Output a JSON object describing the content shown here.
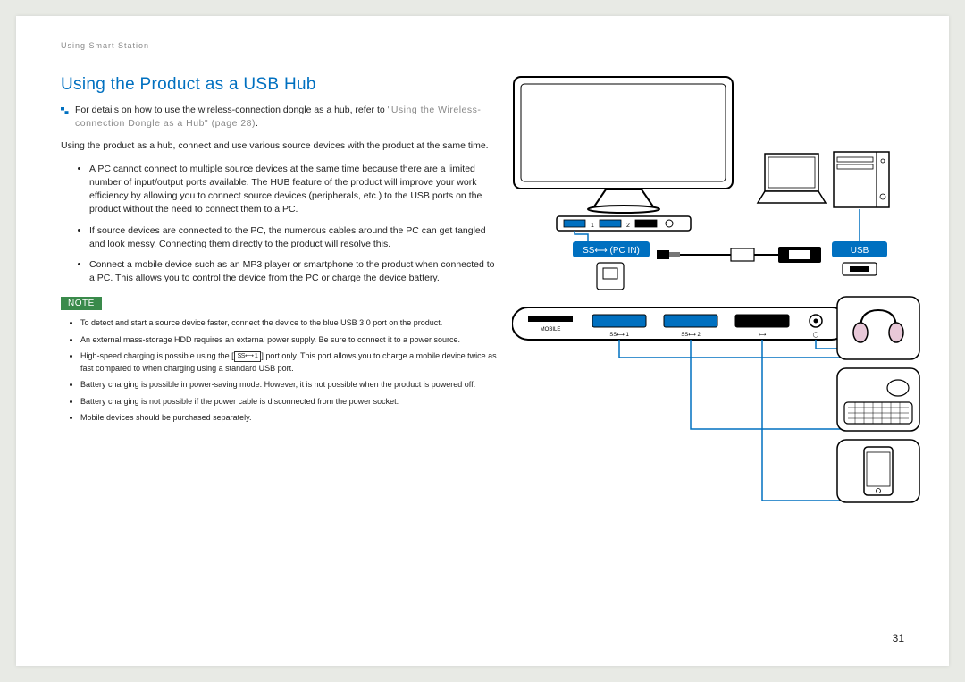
{
  "breadcrumb": "Using Smart Station",
  "title": "Using the Product as a USB Hub",
  "lead_text": "For details on how to use the wireless-connection dongle as a hub, refer to ",
  "lead_ref": "\"Using the Wireless-connection Dongle as a Hub\" (page 28)",
  "lead_period": ".",
  "intro": "Using the product as a hub, connect and use various source devices with the product at the same time.",
  "bullets": [
    "A PC cannot connect to multiple source devices at the same time because there are a limited number of input/output ports available. The HUB feature of the product will improve your work efficiency by allowing you to connect source devices (peripherals, etc.) to the USB ports on the product without the need to connect them to a PC.",
    "If source devices are connected to the PC, the numerous cables around the PC can get tangled and look messy. Connecting them directly to the product will resolve this.",
    "Connect a mobile device such as an MP3 player or smartphone to the product when connected to a PC. This allows you to control the device from the PC or charge the device battery."
  ],
  "note_label": "NOTE",
  "notes": [
    "To detect and start a source device faster, connect the device to the blue USB 3.0 port on the product.",
    "An external mass-storage HDD requires an external power supply. Be sure to connect it to a power source.",
    {
      "pre": "High-speed charging is possible using the [",
      "ss": "SS⟷ 1",
      "post": "] port only. This port allows you to charge a mobile device twice as fast compared to when charging using a standard USB port."
    },
    "Battery charging is possible in power-saving mode. However, it is not possible when the product is powered off.",
    "Battery charging is not possible if the power cable is disconnected from the power socket.",
    "Mobile devices should be purchased separately."
  ],
  "diagram": {
    "pc_in_label": "SS⟷ (PC IN)",
    "usb_label": "USB",
    "strip": {
      "mobile": "MOBILE",
      "ss1": "SS⟷ 1",
      "ss2": "SS⟷ 2",
      "usb": "⟷",
      "audio": "◯"
    }
  },
  "page_number": "31"
}
